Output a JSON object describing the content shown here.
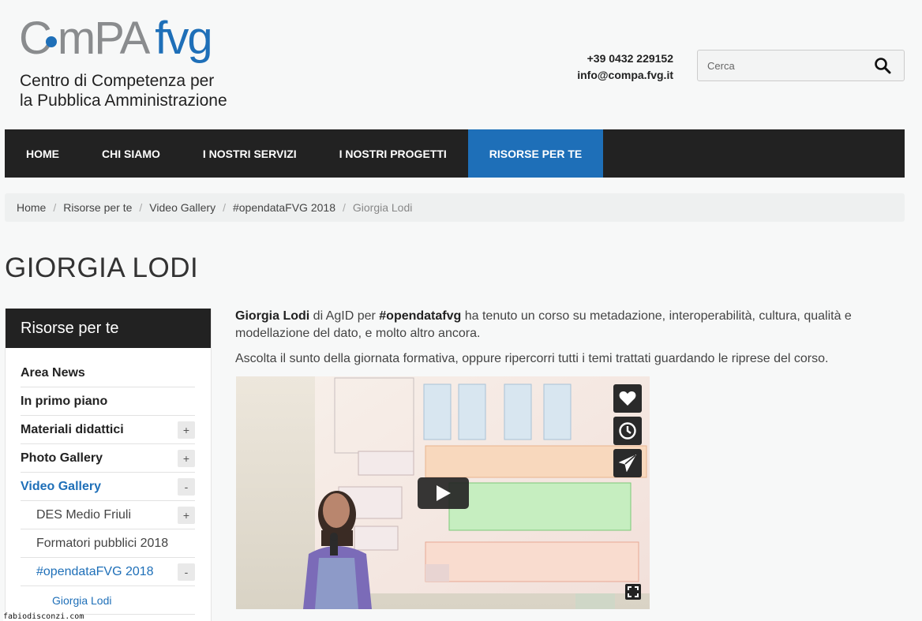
{
  "logo": {
    "part1": "C",
    "part2": "mPA",
    "part3": "fvg",
    "subtitle_line1": "Centro di Competenza per",
    "subtitle_line2": "la Pubblica Amministrazione"
  },
  "contacts": {
    "phone": "+39 0432 229152",
    "email": "info@compa.fvg.it"
  },
  "search": {
    "placeholder": "Cerca"
  },
  "nav": {
    "items": [
      {
        "label": "HOME"
      },
      {
        "label": "CHI SIAMO"
      },
      {
        "label": "I NOSTRI SERVIZI"
      },
      {
        "label": "I NOSTRI PROGETTI"
      },
      {
        "label": "RISORSE PER TE"
      }
    ]
  },
  "breadcrumb": {
    "items": [
      "Home",
      "Risorse per te",
      "Video Gallery",
      "#opendataFVG 2018",
      "Giorgia Lodi"
    ]
  },
  "page": {
    "title": "GIORGIA LODI"
  },
  "sidebar": {
    "heading": "Risorse per te",
    "items": [
      {
        "label": "Area News"
      },
      {
        "label": "In primo piano"
      },
      {
        "label": "Materiali didattici",
        "toggle": "+"
      },
      {
        "label": "Photo Gallery",
        "toggle": "+"
      },
      {
        "label": "Video Gallery",
        "toggle": "-"
      },
      {
        "label": "DES Medio Friuli",
        "toggle": "+"
      },
      {
        "label": "Formatori pubblici 2018"
      },
      {
        "label": "#opendataFVG 2018",
        "toggle": "-"
      },
      {
        "label": "Giorgia Lodi"
      }
    ]
  },
  "content": {
    "p1_name": "Giorgia Lodi",
    "p1_mid": " di AgID per ",
    "p1_tag": "#opendatafvg",
    "p1_rest": " ha tenuto un corso su metadazione, interoperabilità, cultura, qualità e modellazione del dato, e molto altro ancora.",
    "p2": "Ascolta il sunto della giornata formativa, oppure ripercorri tutti i temi trattati guardando le riprese del corso."
  },
  "video": {
    "icons": [
      "heart-icon",
      "clock-icon",
      "send-icon",
      "play-icon",
      "fullscreen-icon"
    ]
  },
  "watermark": "fabiodisconzi.com",
  "colors": {
    "brand_blue": "#1e6fb8",
    "nav_bg": "#222222"
  }
}
